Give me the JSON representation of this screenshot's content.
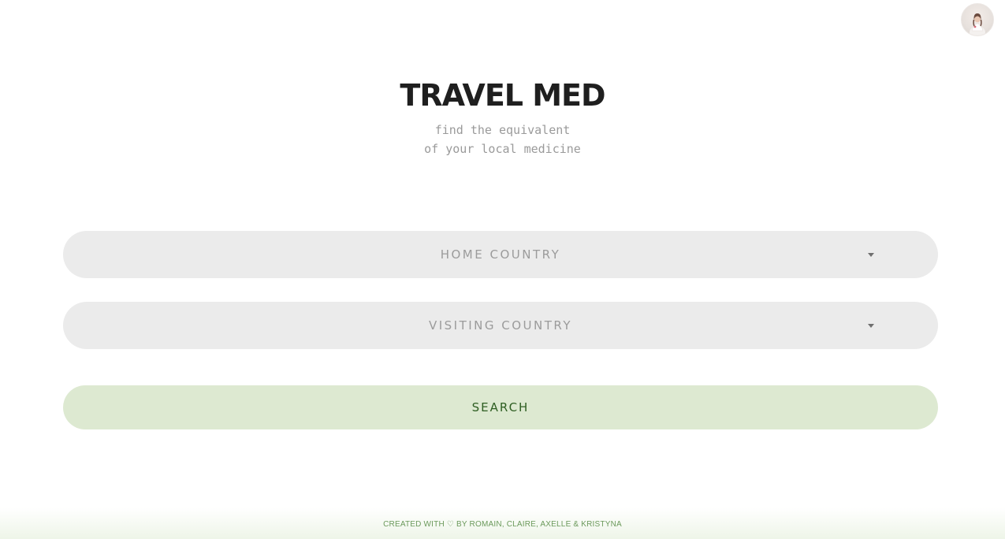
{
  "header": {
    "avatar_alt": "user avatar"
  },
  "hero": {
    "title": "TRAVEL MED",
    "subtitle_line1": "find the equivalent",
    "subtitle_line2": "of your local medicine"
  },
  "form": {
    "home_country": {
      "label": "HOME COUNTRY",
      "icon": "caret-down-icon"
    },
    "visiting_country": {
      "label": "VISITING COUNTRY",
      "icon": "caret-down-icon"
    },
    "search_label": "SEARCH"
  },
  "footer": {
    "text": "CREATED WITH ♡ BY ROMAIN, CLAIRE, AXELLE & KRISTYNA"
  },
  "colors": {
    "title": "#1f1f1f",
    "subtitle": "#9a9a9a",
    "select_bg": "#ebebeb",
    "select_text": "#9b9b9b",
    "search_bg": "#dde9d1",
    "search_text": "#2e5e22",
    "footer_text": "#6c9a5c"
  }
}
